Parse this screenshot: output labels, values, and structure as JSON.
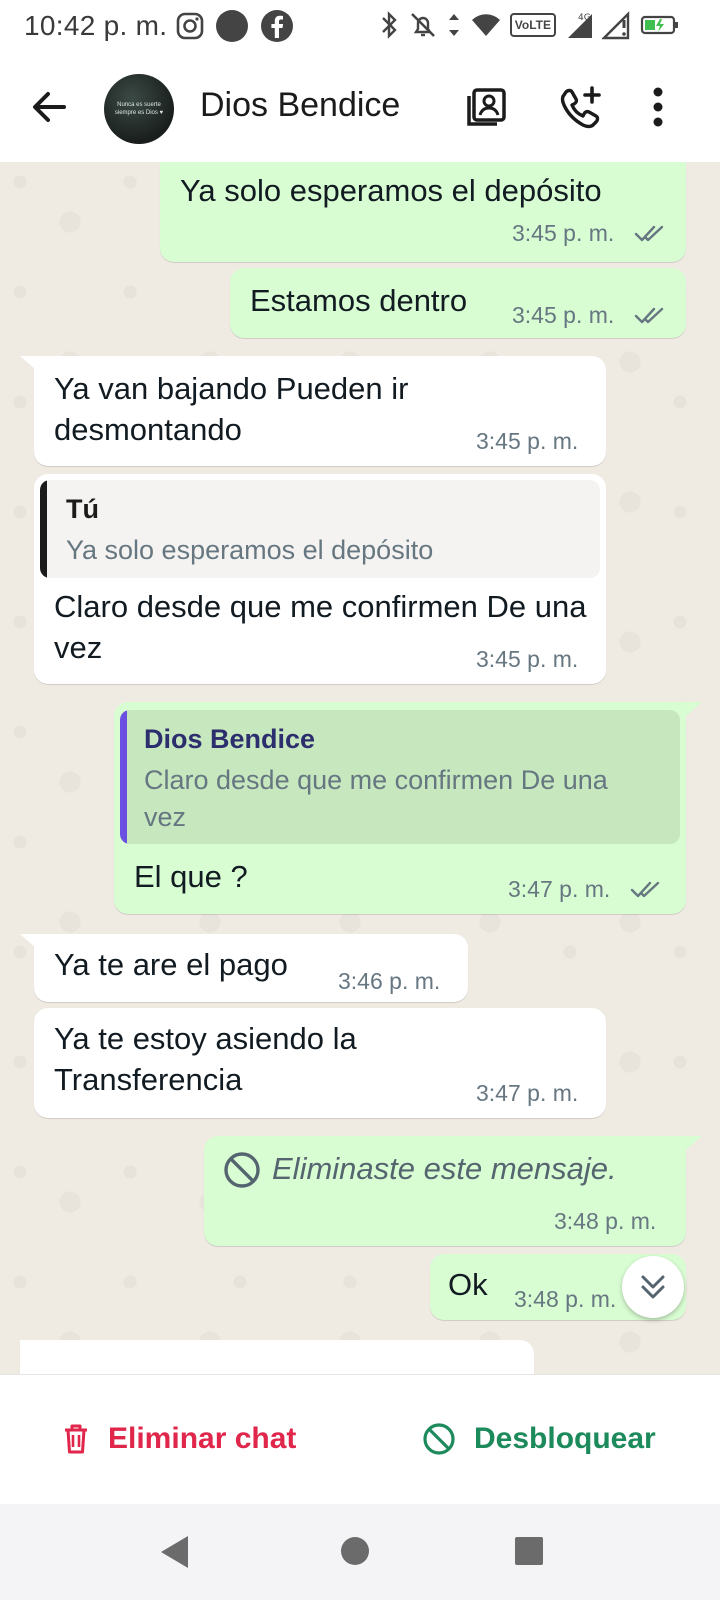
{
  "status_bar": {
    "time": "10:42 p. m.",
    "left_icons": [
      "instagram-icon",
      "circle-notification-icon",
      "facebook-icon"
    ],
    "right_icons": [
      "bluetooth-icon",
      "bell-muted-icon",
      "data-arrows-icon",
      "wifi-icon",
      "volte-icon",
      "signal-icon",
      "signal-2-icon",
      "battery-charging-icon"
    ],
    "volte_label": "VoLTE",
    "network_label": "4G"
  },
  "app_bar": {
    "contact_name": "Dios Bendice",
    "avatar_text": "Nunca es suerte siempre es Dios ♥",
    "icons": [
      "back-arrow-icon",
      "contact-card-icon",
      "add-call-icon",
      "more-vert-icon"
    ]
  },
  "messages": [
    {
      "dir": "out",
      "text": "Ya solo esperamos el depósito",
      "time": "3:45 p. m.",
      "status": "read"
    },
    {
      "dir": "out",
      "text": "Estamos dentro",
      "time": "3:45 p. m.",
      "status": "read"
    },
    {
      "dir": "in",
      "text": "Ya van bajando Pueden ir desmontando",
      "time": "3:45 p. m."
    },
    {
      "dir": "in",
      "quote_author": "Tú",
      "quote_text": "Ya solo esperamos el depósito",
      "text": "Claro desde que me confirmen De una vez",
      "time": "3:45 p. m."
    },
    {
      "dir": "out",
      "quote_author": "Dios Bendice",
      "quote_text": "Claro desde que me confirmen De una vez",
      "text": "El que ?",
      "time": "3:47 p. m.",
      "status": "read"
    },
    {
      "dir": "in",
      "text": "Ya te are el pago",
      "time": "3:46 p. m."
    },
    {
      "dir": "in",
      "text": "Ya te estoy asiendo la Transferencia",
      "time": "3:47 p. m."
    },
    {
      "dir": "out",
      "deleted": true,
      "text": "Eliminaste este mensaje.",
      "time": "3:48 p. m."
    },
    {
      "dir": "out",
      "text": "Ok",
      "time": "3:48 p. m.",
      "status": "read"
    }
  ],
  "actions": {
    "delete_label": "Eliminar chat",
    "unblock_label": "Desbloquear"
  },
  "colors": {
    "outgoing_bubble": "#d9fdd3",
    "incoming_bubble": "#ffffff",
    "chat_background": "#efeae2",
    "read_ticks": "#667781",
    "delete_red": "#e0264b",
    "unblock_green": "#1c8a5a",
    "quote_bar_in": "#1b1b1b",
    "quote_bar_out": "#6b4fe0"
  },
  "nav_bar": {
    "icons": [
      "nav-back-icon",
      "nav-home-icon",
      "nav-recents-icon"
    ]
  }
}
